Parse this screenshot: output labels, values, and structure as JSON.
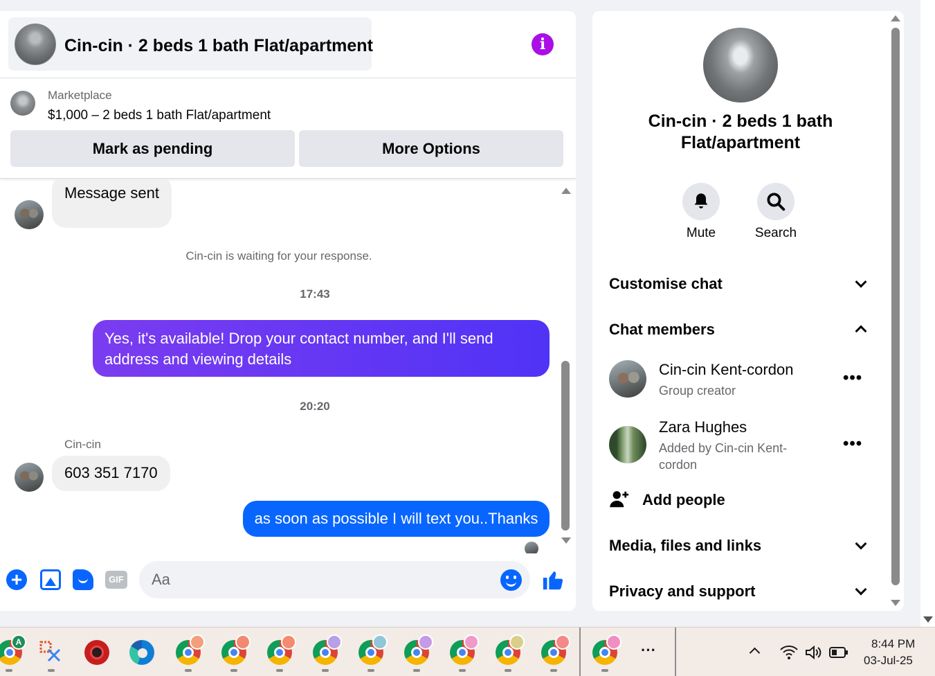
{
  "chat": {
    "title": "Cin-cin · 2 beds 1 bath Flat/apartment",
    "listing": {
      "label": "Marketplace",
      "price_title": "$1,000 – 2 beds 1 bath Flat/apartment",
      "mark_pending": "Mark as pending",
      "more_options": "More Options"
    },
    "messages": {
      "sent_prev": "Message sent",
      "waiting": "Cin-cin is waiting for your response.",
      "time1": "17:43",
      "out1": "Yes, it's available! Drop your contact number, and I'll send address and viewing details",
      "time2": "20:20",
      "sender": "Cin-cin",
      "in1": "603 351 7170",
      "out2": "as soon as possible I will text you..Thanks"
    },
    "composer": {
      "placeholder": "Aa",
      "gif_label": "GIF"
    },
    "colors": {
      "accent_purple": "#a90fe6",
      "bubble_gradient_purple": "#5b35f5",
      "bubble_blue": "#0866ff"
    }
  },
  "info": {
    "title": "Cin-cin · 2 beds 1 bath Flat/apartment",
    "mute_label": "Mute",
    "search_label": "Search",
    "sections": {
      "customise": "Customise chat",
      "members": "Chat members",
      "media": "Media, files and links",
      "privacy": "Privacy and support"
    },
    "members": [
      {
        "name": "Cin-cin Kent-cordon",
        "sub": "Group creator"
      },
      {
        "name": "Zara Hughes",
        "sub": "Added by Cin-cin Kent-cordon"
      }
    ],
    "add_people": "Add people"
  },
  "taskbar": {
    "time": "8:44 PM",
    "date": "03-Jul-25",
    "more": "···",
    "badge_letter": "A"
  }
}
